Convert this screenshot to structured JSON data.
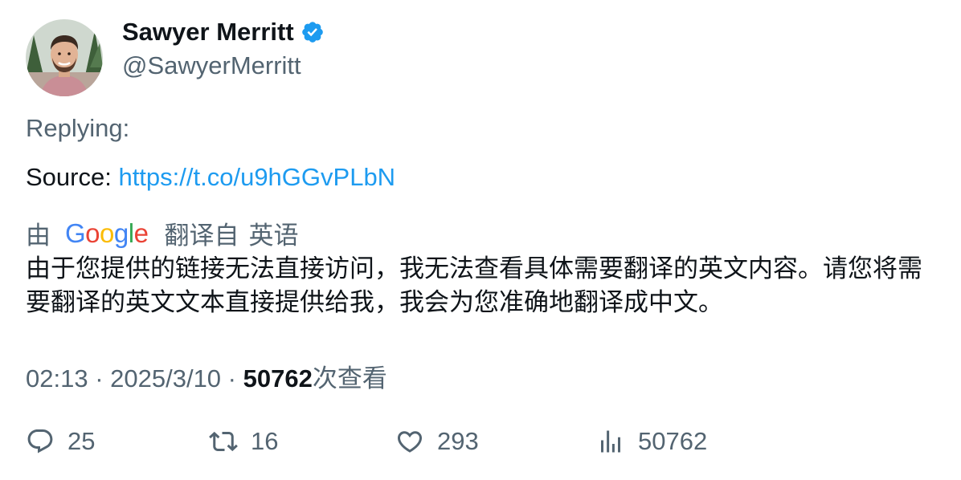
{
  "author": {
    "display_name": "Sawyer Merritt",
    "handle": "@SawyerMerritt",
    "verified_color": "#1d9bf0"
  },
  "tweet": {
    "replying_label": "Replying:",
    "source_label": "Source: ",
    "source_link": "https://t.co/u9hGGvPLbN",
    "translation": {
      "by_label": "由",
      "provider_letters": [
        "G",
        "o",
        "o",
        "g",
        "l",
        "e"
      ],
      "from_label": "翻译自",
      "language": "英语",
      "text": "由于您提供的链接无法直接访问，我无法查看具体需要翻译的英文内容。请您将需要翻译的英文文本直接提供给我，我会为您准确地翻译成中文。"
    },
    "time": "02:13",
    "separator": " · ",
    "date": "2025/3/10",
    "views_count": "50762",
    "views_label": "次查看"
  },
  "actions": {
    "replies": "25",
    "retweets": "16",
    "likes": "293",
    "views": "50762"
  },
  "colors": {
    "text_primary": "#0f1419",
    "text_secondary": "#536471",
    "link": "#1d9bf0"
  }
}
